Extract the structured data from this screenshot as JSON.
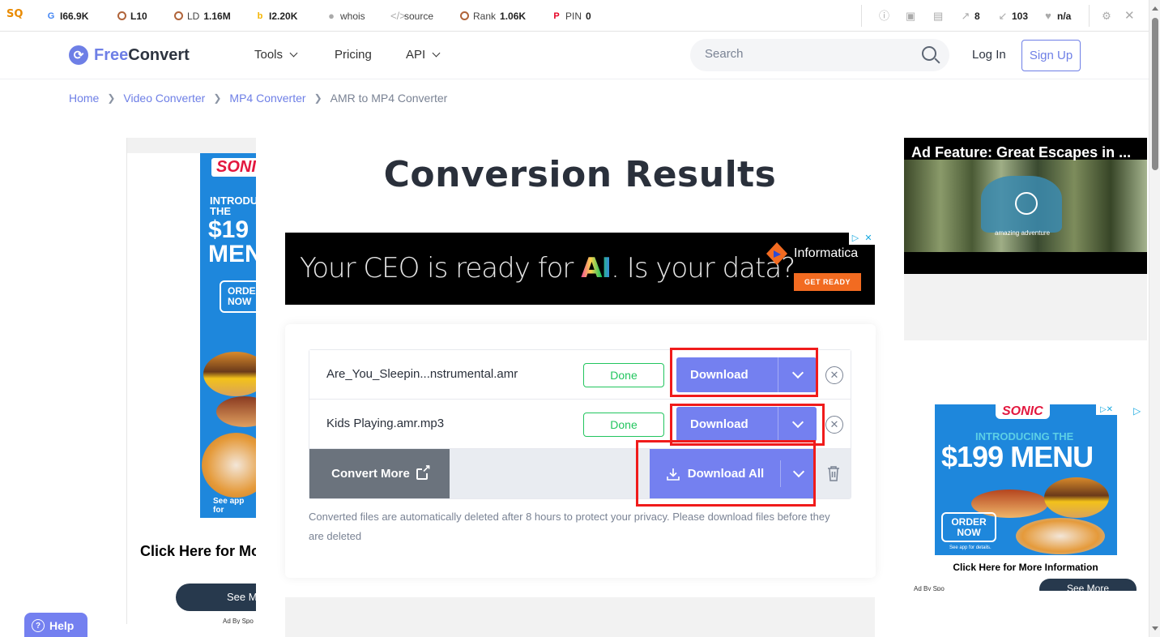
{
  "seo_toolbar": {
    "google": "I66.9K",
    "links": "L10",
    "linking_domains_label": "LD",
    "linking_domains_value": "1.16M",
    "bing": "I2.20K",
    "whois": "whois",
    "source": "source",
    "rank_label": "Rank",
    "rank_value": "1.06K",
    "pin_label": "PIN",
    "pin_value": "0",
    "external_links": "8",
    "internal_links": "103",
    "health": "n/a"
  },
  "header": {
    "logo_free": "Free",
    "logo_convert": "Convert",
    "nav": [
      {
        "label": "Tools",
        "has_dropdown": true
      },
      {
        "label": "Pricing",
        "has_dropdown": false
      },
      {
        "label": "API",
        "has_dropdown": true
      }
    ],
    "search_placeholder": "Search",
    "login": "Log In",
    "signup": "Sign Up"
  },
  "breadcrumb": [
    {
      "label": "Home",
      "link": true
    },
    {
      "label": "Video Converter",
      "link": true
    },
    {
      "label": "MP4 Converter",
      "link": true
    },
    {
      "label": "AMR to MP4 Converter",
      "link": false
    }
  ],
  "main": {
    "title": "Conversion Results",
    "files": [
      {
        "name": "Are_You_Sleepin...nstrumental.amr",
        "status": "Done",
        "action": "Download"
      },
      {
        "name": "Kids Playing.amr.mp3",
        "status": "Done",
        "action": "Download"
      }
    ],
    "convert_more": "Convert More",
    "download_all": "Download All",
    "note": "Converted files are automatically deleted after 8 hours to protect your privacy. Please download files before they are deleted"
  },
  "ads": {
    "banner": {
      "headline_pre": "Your CEO is ready for ",
      "headline_ai": "AI",
      "headline_post": ". Is your data?",
      "brand": "Informatica",
      "cta": "GET READY"
    },
    "left": {
      "brand": "SONIC",
      "intro": "INTRODU THE",
      "price": "$19 MEN",
      "order": "ORDE NOW",
      "see_app": "See app for",
      "click_here": "Click Here for Mo",
      "see_more": "See M",
      "ad_by": "Ad By Spo"
    },
    "video": {
      "title": "Ad Feature: Great Escapes in ...",
      "overlay": "amazing adventure"
    },
    "right": {
      "brand": "SONIC",
      "intro": "INTRODUCING THE",
      "price": "$199 MENU",
      "order": "ORDER NOW",
      "see_app": "See app for details.",
      "click_here": "Click Here for More Information",
      "see_more": "See More",
      "ad_by": "Ad By Spo"
    }
  },
  "help": "Help",
  "colors": {
    "accent": "#7480f0",
    "done_green": "#22c55e",
    "convert_more_bg": "#6b737d",
    "highlight_red": "#f01b1b"
  }
}
